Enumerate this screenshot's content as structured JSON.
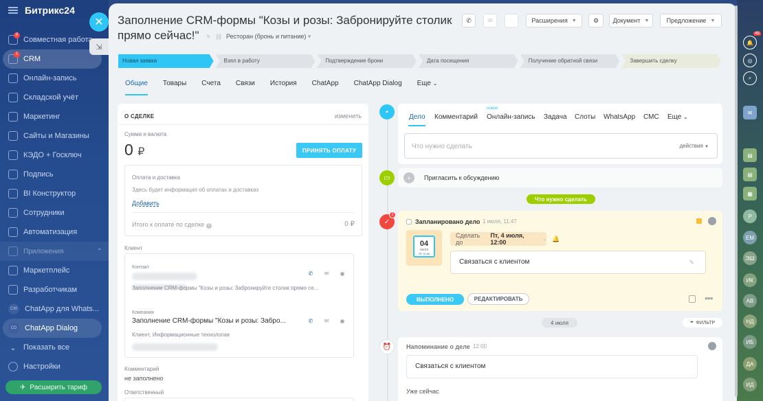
{
  "sidebar": {
    "logo": "Битрикс24",
    "items": [
      {
        "label": "Совместная работа",
        "badge": "6"
      },
      {
        "label": "CRM",
        "badge": "1"
      },
      {
        "label": "Онлайн-запись"
      },
      {
        "label": "Складской учёт"
      },
      {
        "label": "Маркетинг"
      },
      {
        "label": "Сайты и Магазины"
      },
      {
        "label": "КЭДО + Госключ"
      },
      {
        "label": "Подпись"
      },
      {
        "label": "BI Конструктор"
      },
      {
        "label": "Сотрудники"
      },
      {
        "label": "Автоматизация"
      }
    ],
    "apps_section": "Приложения",
    "apps": [
      {
        "label": "Маркетплейс"
      },
      {
        "label": "Разработчикам"
      },
      {
        "label": "ChatApp для Whats...",
        "short": "CW"
      },
      {
        "label": "ChatApp Dialog",
        "short": "CD"
      }
    ],
    "show_all": "Показать все",
    "settings": "Настройки",
    "upgrade": "Расширить тариф"
  },
  "header": {
    "title": "Заполнение CRM-формы \"Козы и розы: Забронируйте столик прямо сейчас!\"",
    "subtitle": "Ресторан (бронь и питание)",
    "extensions": "Расширения",
    "document": "Документ",
    "offer": "Предложение"
  },
  "stages": [
    "Новая заявка",
    "Взял в работу",
    "Подтверждение брони",
    "Дата посещения",
    "Получение обратной связи",
    "Завершить сделку"
  ],
  "tabs": [
    "Общие",
    "Товары",
    "Счета",
    "Связи",
    "История",
    "ChatApp",
    "ChatApp Dialog",
    "Еще"
  ],
  "deal": {
    "section_title": "О СДЕЛКЕ",
    "change": "изменить",
    "amount_label": "Сумма и валюта",
    "amount": "0",
    "currency": "₽",
    "pay_button": "ПРИНЯТЬ ОПЛАТУ",
    "payment_title": "Оплата и доставка",
    "payment_info": "Здесь будет информация об оплатах и доставках",
    "add": "Добавить",
    "total_label": "Итого к оплате по сделке",
    "total_value": "0 ₽",
    "client_label": "Клиент",
    "contact_label": "Контакт",
    "contact_source": "Заполнение CRM-формы \"Козы и розы: Забронируйте столик прямо се...",
    "company_label": "Компания",
    "company_name": "Заполнение CRM-формы \"Козы и розы: Забро...",
    "company_type": "Клиент, Информационные технологии",
    "comment_label": "Комментарий",
    "comment_value": "не заполнено",
    "responsible_label": "Ответственный"
  },
  "editor": {
    "tabs": [
      "Дело",
      "Комментарий",
      "Онлайн-запись",
      "Задача",
      "Слоты",
      "WhatsApp",
      "СМС",
      "Еще"
    ],
    "new_badge": "новое",
    "placeholder": "Что нужно сделать",
    "actions": "действия"
  },
  "invite": "Пригласить к обсуждению",
  "todo_pill": "Что нужно сделать",
  "task": {
    "badge": "1",
    "title": "Запланировано дело",
    "time": "1 июля, 11:47",
    "cal_day": "04",
    "cal_month": "июля",
    "cal_time": "ПТ 12:00",
    "due_prefix": "Сделать до",
    "due_value": "Пт, 4 июля, 12:00",
    "text": "Связаться с клиентом",
    "done_button": "ВЫПОЛНЕНО",
    "edit_button": "РЕДАКТИРОВАТЬ"
  },
  "date_separator": "4 июля",
  "filter": "ФИЛЬТР",
  "reminder": {
    "title": "Напоминание о деле",
    "time": "12:00",
    "text": "Связаться с клиентом",
    "footer": "Уже сейчас"
  },
  "rail": {
    "notif_badge": "48",
    "avatars": [
      "Р",
      "ЕМ",
      "ЭШ",
      "ИК",
      "АВ",
      "НД",
      "ИБ",
      "ДА",
      "ИД"
    ]
  },
  "colors": {
    "accent": "#2fc6f6",
    "green": "#9dcf00",
    "sidebar": "#1e3f7e",
    "danger": "#f44"
  }
}
